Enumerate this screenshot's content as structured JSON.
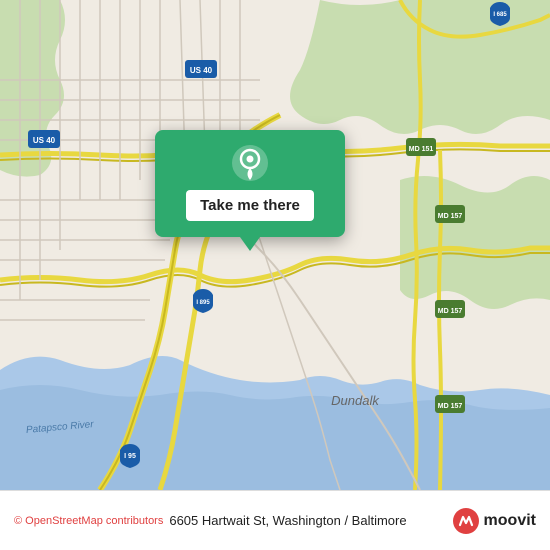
{
  "map": {
    "background_color": "#e8e0d8"
  },
  "popup": {
    "button_label": "Take me there",
    "bg_color": "#2eaa6e"
  },
  "bottom_bar": {
    "osm_credit": "© OpenStreetMap contributors",
    "address": "6605 Hartwait St, Washington / Baltimore",
    "moovit_label": "moovit"
  }
}
